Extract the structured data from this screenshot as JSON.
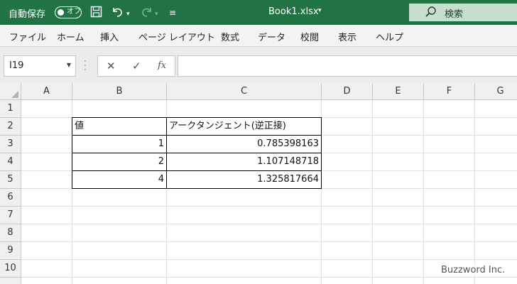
{
  "titlebar": {
    "autosave_label": "自動保存",
    "autosave_state": "オフ",
    "filename": "Book1.xlsx",
    "search_label": "検索"
  },
  "ribbon": {
    "tabs": [
      "ファイル",
      "ホーム",
      "挿入",
      "ページ レイアウト",
      "数式",
      "データ",
      "校閲",
      "表示",
      "ヘルプ"
    ]
  },
  "formula_bar": {
    "name_box": "I19",
    "fx_label": "fx",
    "formula": ""
  },
  "grid": {
    "columns": [
      "A",
      "B",
      "C",
      "D",
      "E",
      "F",
      "G"
    ],
    "rows": [
      "1",
      "2",
      "3",
      "4",
      "5",
      "6",
      "7",
      "8",
      "9",
      "10"
    ],
    "header_b": "値",
    "header_c": "アークタンジェント(逆正接)",
    "values": [
      "1",
      "2",
      "4"
    ],
    "results": [
      "0.785398163",
      "1.107148718",
      "1.325817664"
    ]
  },
  "watermark": "Buzzword Inc.",
  "colors": {
    "titlebar": "#217346",
    "ribbon": "#f3f3f3",
    "header_bg": "#f0f0f0"
  }
}
